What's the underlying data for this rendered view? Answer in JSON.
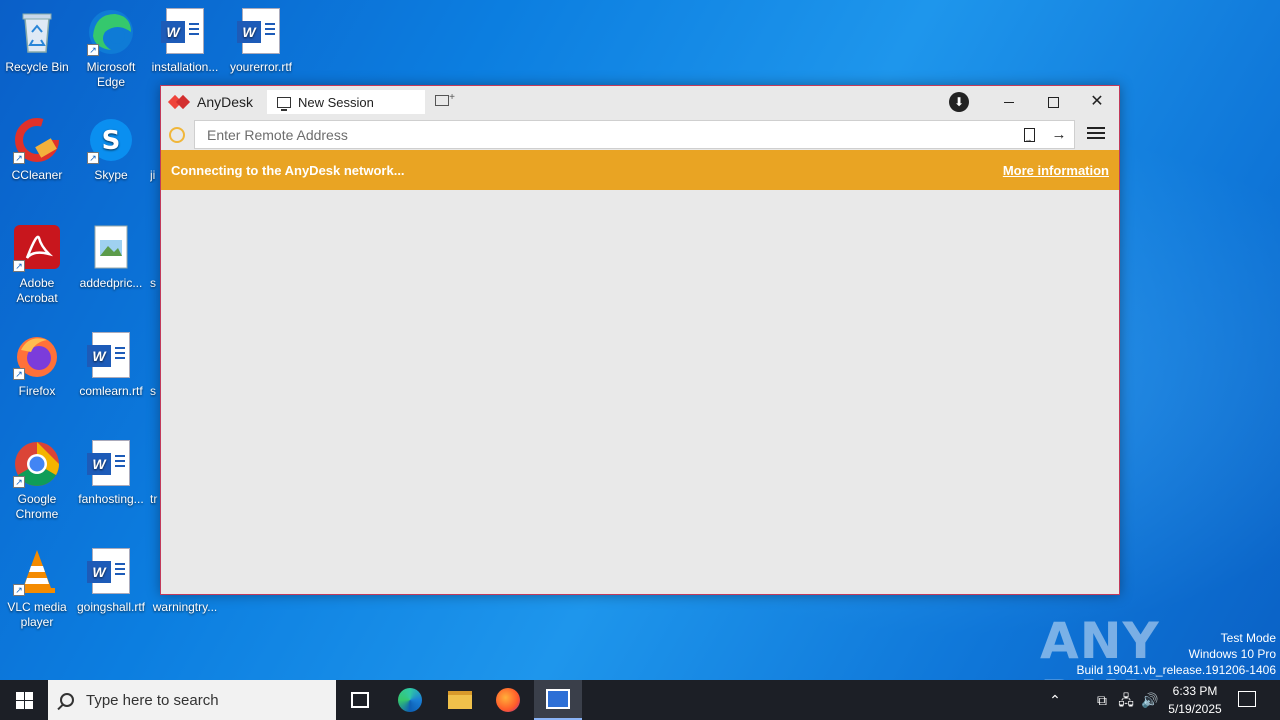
{
  "desktop": {
    "icons": [
      {
        "label": "Recycle Bin",
        "icon": "recycle-bin-icon"
      },
      {
        "label": "Microsoft Edge",
        "icon": "edge-icon"
      },
      {
        "label": "installation...",
        "icon": "word-document-icon"
      },
      {
        "label": "yourerror.rtf",
        "icon": "word-document-icon"
      },
      {
        "label": "CCleaner",
        "icon": "ccleaner-icon"
      },
      {
        "label": "Skype",
        "icon": "skype-icon"
      },
      {
        "label": "Adobe Acrobat",
        "icon": "acrobat-icon"
      },
      {
        "label": "addedpric...",
        "icon": "image-file-icon"
      },
      {
        "label": "Firefox",
        "icon": "firefox-icon"
      },
      {
        "label": "comlearn.rtf",
        "icon": "word-document-icon"
      },
      {
        "label": "Google Chrome",
        "icon": "chrome-icon"
      },
      {
        "label": "fanhosting...",
        "icon": "word-document-icon"
      },
      {
        "label": "VLC media player",
        "icon": "vlc-icon"
      },
      {
        "label": "goingshall.rtf",
        "icon": "word-document-icon"
      },
      {
        "label": "warningtry...",
        "icon": "word-document-icon"
      }
    ],
    "partial_labels": [
      "ji",
      "s",
      "s",
      "tr"
    ]
  },
  "anydesk": {
    "brand": "AnyDesk",
    "tab_label": "New Session",
    "address_placeholder": "Enter Remote Address",
    "banner_text": "Connecting to the AnyDesk network...",
    "banner_link": "More information",
    "banner_color": "#e9a423",
    "status_color": "#f0b63a"
  },
  "watermark": {
    "text": "ANY RUN",
    "test_mode": "Test Mode",
    "os": "Windows 10 Pro",
    "build": "Build 19041.vb_release.191206-1406"
  },
  "taskbar": {
    "search_placeholder": "Type here to search",
    "time": "6:33 PM",
    "date": "5/19/2025"
  }
}
